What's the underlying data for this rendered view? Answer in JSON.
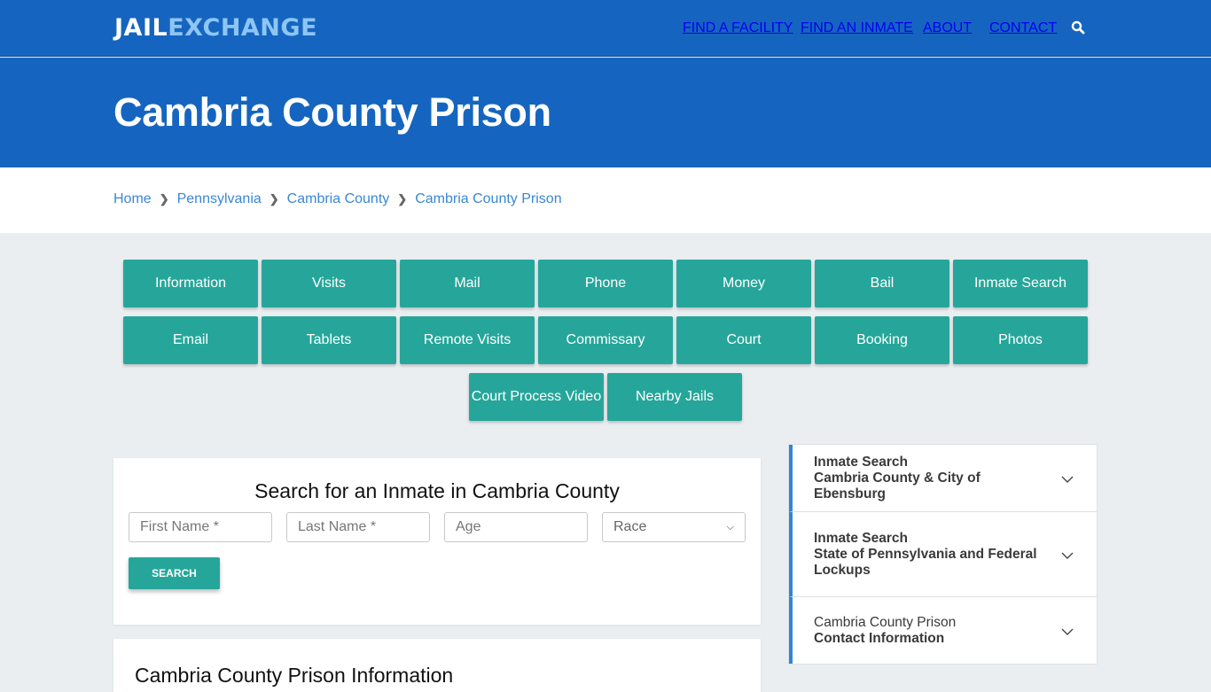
{
  "brand": {
    "part1": "JAIL",
    "part2": "EXCHANGE"
  },
  "nav": {
    "items": [
      "FIND A FACILITY",
      "FIND AN INMATE",
      "ABOUT",
      "CONTACT"
    ],
    "search_icon": "search-icon"
  },
  "page_title": "Cambria County Prison",
  "breadcrumb": [
    "Home",
    "Pennsylvania",
    "Cambria County",
    "Cambria County Prison"
  ],
  "topic_buttons": {
    "row1": [
      "Information",
      "Visits",
      "Mail",
      "Phone",
      "Money",
      "Bail",
      "Inmate Search"
    ],
    "row2": [
      "Email",
      "Tablets",
      "Remote Visits",
      "Commissary",
      "Court",
      "Booking",
      "Photos"
    ],
    "row3": [
      "Court Process Video",
      "Nearby Jails"
    ]
  },
  "search_form": {
    "title": "Search for an Inmate in Cambria County",
    "first_name_placeholder": "First Name *",
    "last_name_placeholder": "Last Name *",
    "age_placeholder": "Age",
    "race_selected": "Race",
    "submit_label": "SEARCH"
  },
  "info_section": {
    "title": "Cambria County Prison Information"
  },
  "sidebar": {
    "items": [
      {
        "line1": "Inmate Search",
        "line2": "Cambria County & City of Ebensburg"
      },
      {
        "line1": "Inmate Search",
        "line2": "State of Pennsylvania and Federal Lockups"
      },
      {
        "line1": "Cambria County Prison",
        "line2": "Contact Information"
      }
    ]
  },
  "colors": {
    "primary": "#1565c0",
    "accent": "#26a69a",
    "link": "#3a87d4",
    "logo_light": "#8ec5f5"
  }
}
